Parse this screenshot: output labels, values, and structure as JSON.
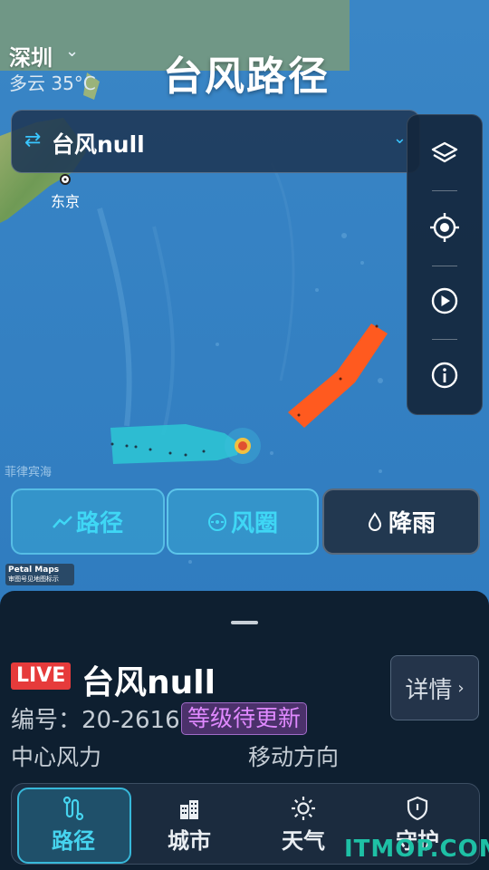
{
  "header": {
    "city": "深圳",
    "weather": "多云 35°C",
    "title": "台风路径"
  },
  "selector": {
    "label": "台风null"
  },
  "map": {
    "tokyo_label": "东京",
    "sea_label": "菲律宾海",
    "credit_line1": "Petal Maps",
    "credit_line2": "审图号见地图标示"
  },
  "toolbar": {
    "icons": [
      "layers-icon",
      "locate-icon",
      "play-icon",
      "info-icon"
    ]
  },
  "layer_buttons": {
    "path": "路径",
    "wind": "风圈",
    "rain": "降雨"
  },
  "typhoon": {
    "live": "LIVE",
    "name": "台风null",
    "code": "编号：20-2616",
    "grade": "等级待更新",
    "details": "详情",
    "center_wind": "中心风力",
    "move_direction": "移动方向"
  },
  "navbar": {
    "items": [
      {
        "label": "路径",
        "icon": "route-icon",
        "active": true
      },
      {
        "label": "城市",
        "icon": "city-icon",
        "active": false
      },
      {
        "label": "天气",
        "icon": "sun-icon",
        "active": false
      },
      {
        "label": "守护",
        "icon": "shield-icon",
        "active": false
      }
    ]
  },
  "watermark": "ITMOP.COM",
  "colors": {
    "accent": "#39c6ff",
    "path_color": "#2cc3d4",
    "forecast_color": "#ff5a1f",
    "live_red": "#e63b3b",
    "grade_purple": "#e089ff"
  }
}
